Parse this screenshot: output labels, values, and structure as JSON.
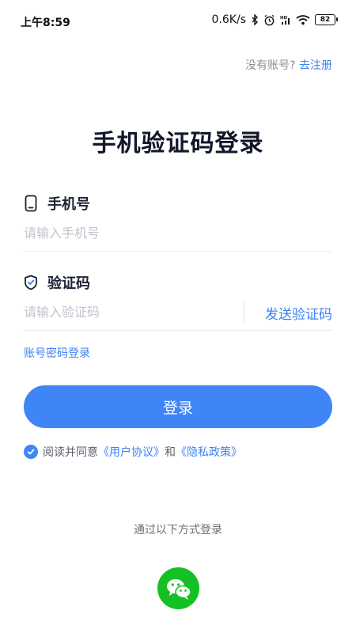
{
  "status_bar": {
    "time": "上午8:59",
    "net_speed": "0.6K/s",
    "battery": "82",
    "icons": [
      "bluetooth-icon",
      "alarm-icon",
      "hd-signal-icon",
      "wifi-icon",
      "battery-icon"
    ]
  },
  "header": {
    "no_account_text": "没有账号?",
    "register_link": "去注册"
  },
  "title": "手机验证码登录",
  "phone": {
    "label": "手机号",
    "icon": "phone-icon",
    "placeholder": "请输入手机号"
  },
  "code": {
    "label": "验证码",
    "icon": "shield-icon",
    "placeholder": "请输入验证码",
    "send_label": "发送验证码"
  },
  "password_login_link": "账号密码登录",
  "login_button": "登录",
  "agreement": {
    "prefix": "阅读并同意",
    "user_agreement": "《用户协议》",
    "and": "和",
    "privacy_policy": "《隐私政策》",
    "checked": true
  },
  "other_login_text": "通过以下方式登录",
  "social": {
    "icon": "wechat-icon",
    "color": "#14c124"
  },
  "colors": {
    "accent": "#3f85f6",
    "link": "#3d82f5",
    "title": "#12172b"
  }
}
